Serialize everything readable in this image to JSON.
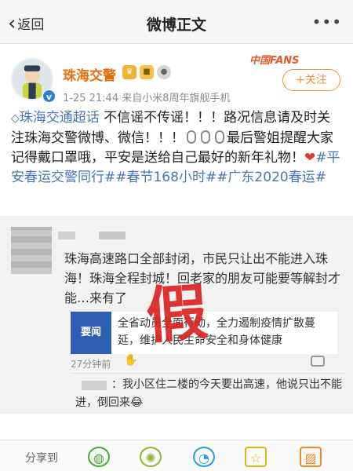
{
  "navbar": {
    "back_label": "返回",
    "title": "微博正文",
    "more": "•••"
  },
  "post": {
    "author": "珠海交警",
    "fans_deco": "中国FANS",
    "follow_label": "+关注",
    "meta": "1-25 21:44  来自小米8周年旗舰手机",
    "content": {
      "topic1": "珠海交通超话",
      "text1": " 不信谣不传谣！！！路况信息请及时关注珠海交警微博、微信！！！",
      "text2": "最后警姐提醒大家记得戴口罩哦，平安是送给自己最好的新年礼物！",
      "topic2": "#平安春运交警同行#",
      "topic3": "#春节168小时#",
      "topic4": "#广东2020春运#"
    }
  },
  "repost": {
    "text": "珠海高速路口全部封闭，市民只让出不能进入珠海！珠海全程封城！回老家的朋友可能要等解封才能…来有了",
    "card_icon_label": "要闻",
    "card_text": "全省动员全面行动，全力遏制疫情扩散蔓延，维护人民生命安全和身体健康",
    "time": "27分钟前",
    "reply_text": "：我小区住二楼的今天要出高速，他说只出不能进，倒回来😂"
  },
  "stamp": "假",
  "share": {
    "label": "分享到"
  },
  "colors": {
    "author": "#e46e0b",
    "link": "#4a76b4",
    "stamp": "#d9201f",
    "follow": "#f39237"
  }
}
